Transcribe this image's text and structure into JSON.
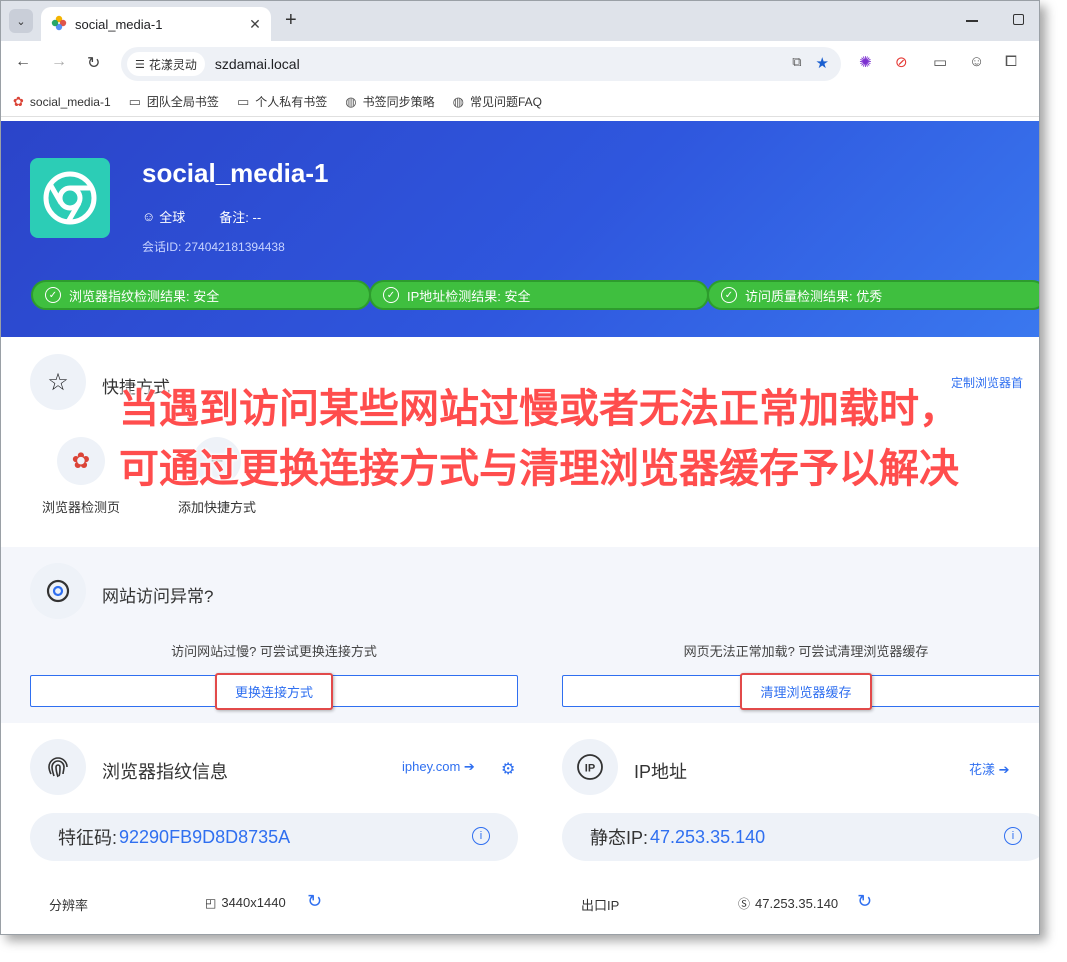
{
  "browser": {
    "tab_title": "social_media-1",
    "chip_label": "花漾灵动",
    "url": "szdamai.local",
    "bookmarks": [
      "social_media-1",
      "团队全局书签",
      "个人私有书签",
      "书签同步策略",
      "常见问题FAQ"
    ]
  },
  "hero": {
    "title": "social_media-1",
    "region": "全球",
    "note": "备注: --",
    "session": "会话ID: 274042181394438",
    "checks": [
      "浏览器指纹检测结果: 安全",
      "IP地址检测结果: 安全",
      "访问质量检测结果: 优秀"
    ]
  },
  "quick": {
    "title": "快捷方式",
    "customize": "定制浏览器首",
    "items": [
      "浏览器检测页",
      "添加快捷方式"
    ]
  },
  "overlay": {
    "line1": "当遇到访问某些网站过慢或者无法正常加载时，",
    "line2": "可通过更换连接方式与清理浏览器缓存予以解决"
  },
  "anomaly": {
    "title": "网站访问异常?",
    "hint_left": "访问网站过慢? 可尝试更换连接方式",
    "hint_right": "网页无法正常加载? 可尝试清理浏览器缓存",
    "btn_left": "更换连接方式",
    "btn_right": "清理浏览器缓存"
  },
  "fingerprint": {
    "title": "浏览器指纹信息",
    "link": "iphey.com",
    "code_label": "特征码:",
    "code_value": "92290FB9D8D8735A",
    "row_label": "分辨率",
    "row_value": "3440x1440"
  },
  "ip": {
    "title": "IP地址",
    "link": "花漾",
    "static_label": "静态IP:",
    "static_value": "47.253.35.140",
    "row_label": "出口IP",
    "row_value": "47.253.35.140"
  },
  "colors": {
    "brand_blue": "#2f57de",
    "safe_green": "#3fbf3f",
    "link_blue": "#2f6ff0",
    "highlight_red": "#e24a4a"
  }
}
